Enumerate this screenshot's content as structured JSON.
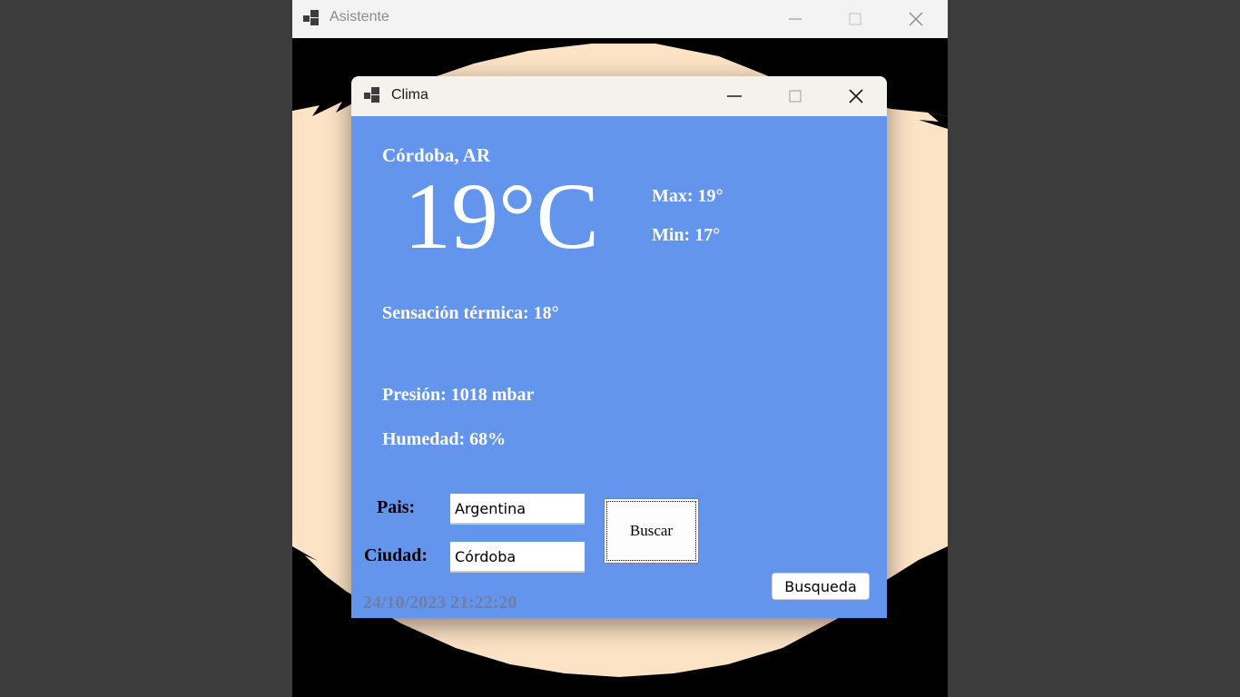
{
  "outer_window": {
    "title": "Asistente",
    "colors": {
      "backdrop": "#3d3c3c",
      "titlebar": "#f3f3f3",
      "cream": "#fde3c5",
      "brush": "#000000"
    }
  },
  "clima_window": {
    "title": "Clima",
    "background": "#6495ed",
    "city": "Córdoba, AR",
    "temperature": "19°C",
    "max": "Max: 19°",
    "min": "Min: 17°",
    "feels_like": "Sensación térmica: 18°",
    "pressure": "Presión: 1018 mbar",
    "humidity": "Humedad: 68%",
    "form": {
      "country_label": "Pais:",
      "country_value": "Argentina",
      "city_label": "Ciudad:",
      "city_value": "Córdoba",
      "search_button": "Buscar",
      "history_button": "Busqueda"
    },
    "datetime": "24/10/2023 21:22:20"
  },
  "icons": [
    "app-icon",
    "minimize-icon",
    "maximize-icon",
    "close-icon"
  ]
}
